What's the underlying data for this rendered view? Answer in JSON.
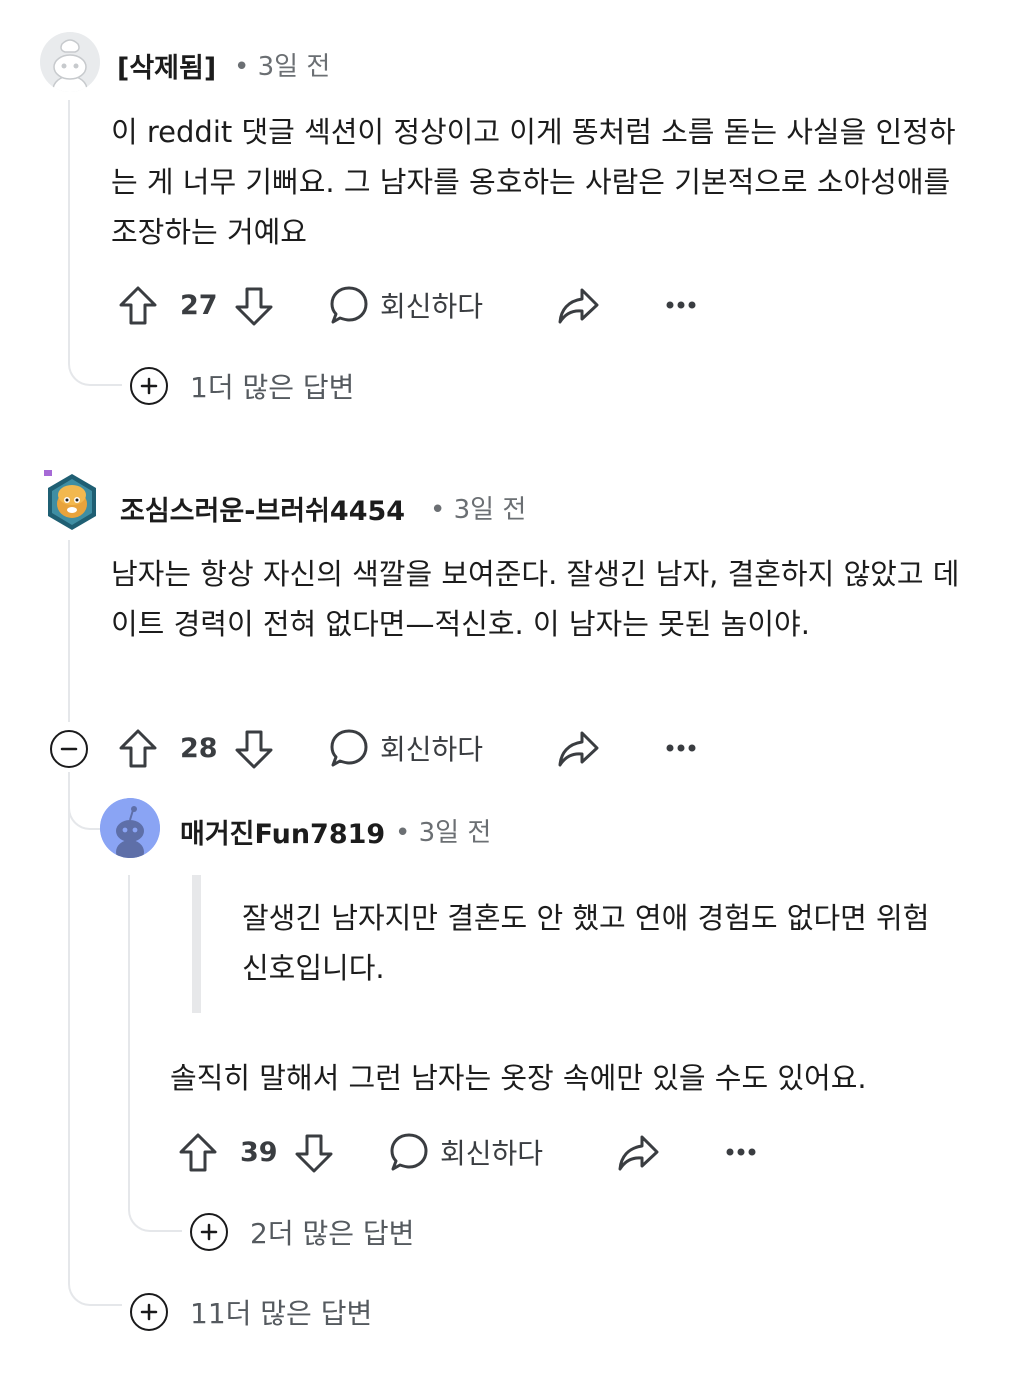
{
  "comments": [
    {
      "author": "[삭제됨]",
      "time": "• 3일 전",
      "body": "이 reddit 댓글 섹션이 정상이고 이게 똥처럼 소름 돋는 사실을 인정하는 게 너무 기뻐요. 그 남자를 옹호하는 사람은 기본적으로 소아성애를 조장하는 거예요",
      "votes": "27",
      "reply_label": "회신하다",
      "more_replies": "1더 많은 답변",
      "avatar_icon": "snoo-default-avatar-icon"
    },
    {
      "author": "조심스러운-브러쉬4454",
      "time": "• 3일 전",
      "body": "남자는 항상 자신의 색깔을 보여준다. 잘생긴 남자, 결혼하지 않았고 데이트 경력이 전혀 없다면—적신호. 이 남자는 못된 놈이야.",
      "votes": "28",
      "reply_label": "회신하다",
      "more_replies": "11더 많은 답변",
      "avatar_icon": "custom-snoo-avatar-icon"
    },
    {
      "author": "매거진Fun7819",
      "time": "• 3일 전",
      "quote": "잘생긴 남자지만 결혼도 안 했고 연애 경험도 없다면 위험 신호입니다.",
      "body": "솔직히 말해서 그런 남자는 옷장 속에만 있을 수도 있어요.",
      "votes": "39",
      "reply_label": "회신하다",
      "more_replies": "2더 많은 답변",
      "avatar_icon": "snoo-blue-avatar-icon"
    }
  ],
  "colors": {
    "thread_line": "#e5e7ea",
    "text": "#1c1c1c",
    "meta": "#6b6f73",
    "avatar_blue": "#8aa4f4"
  }
}
